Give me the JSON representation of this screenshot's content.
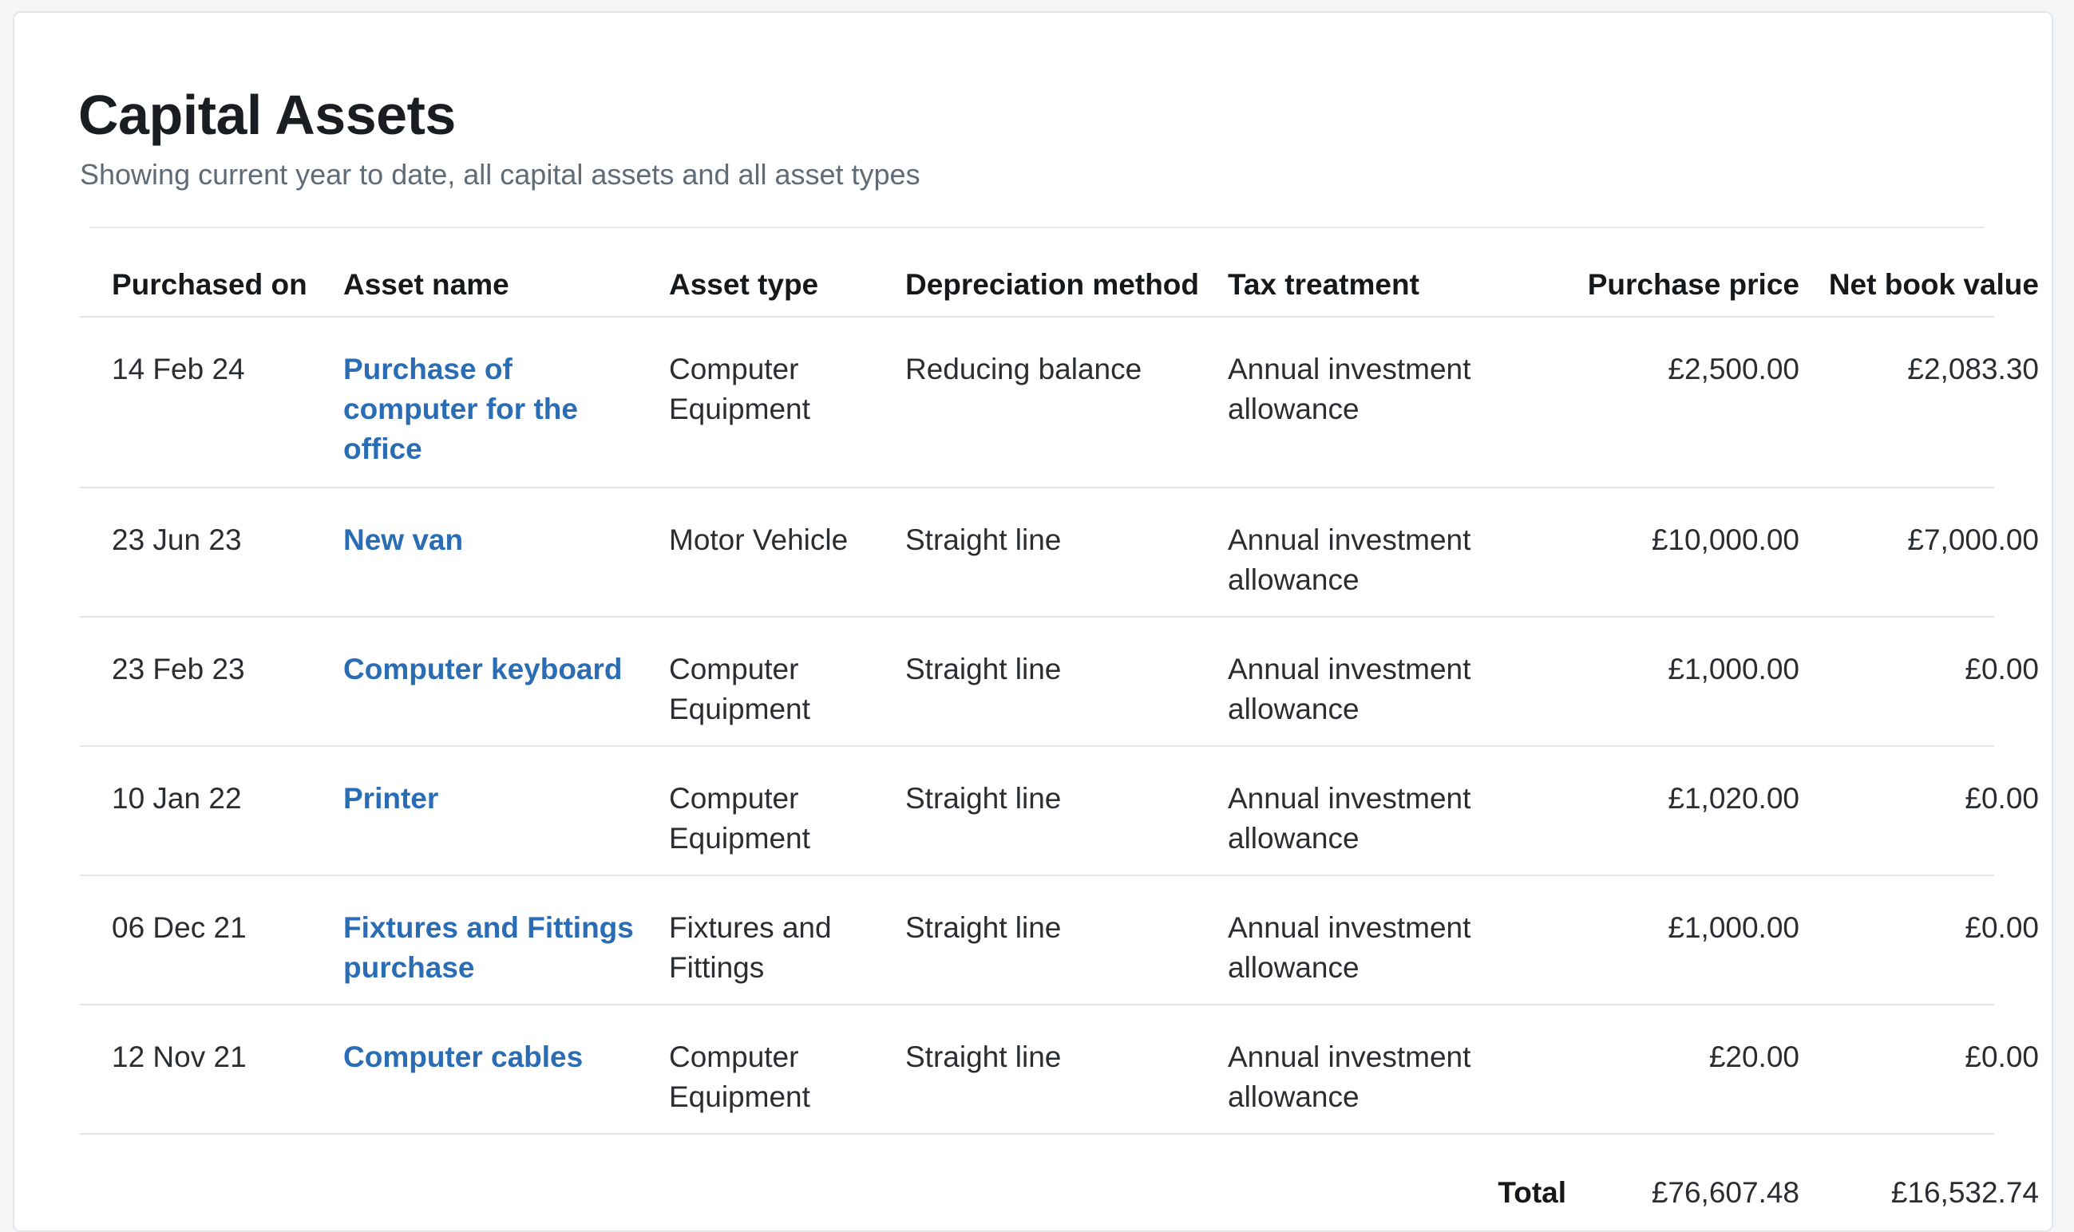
{
  "page": {
    "title": "Capital Assets",
    "subtitle": "Showing current year to date, all capital assets and all asset types"
  },
  "table": {
    "headers": {
      "purchased_on": "Purchased on",
      "asset_name": "Asset name",
      "asset_type": "Asset type",
      "depreciation_method": "Depreciation method",
      "tax_treatment": "Tax treatment",
      "purchase_price": "Purchase price",
      "net_book_value": "Net book value"
    },
    "rows": [
      {
        "purchased_on": "14 Feb 24",
        "asset_name": "Purchase of computer for the office",
        "asset_type": "Computer Equipment",
        "depreciation_method": "Reducing balance",
        "tax_treatment": "Annual investment allowance",
        "purchase_price": "£2,500.00",
        "net_book_value": "£2,083.30"
      },
      {
        "purchased_on": "23 Jun 23",
        "asset_name": "New van",
        "asset_type": "Motor Vehicle",
        "depreciation_method": "Straight line",
        "tax_treatment": "Annual investment allowance",
        "purchase_price": "£10,000.00",
        "net_book_value": "£7,000.00"
      },
      {
        "purchased_on": "23 Feb 23",
        "asset_name": "Computer keyboard",
        "asset_type": "Computer Equipment",
        "depreciation_method": "Straight line",
        "tax_treatment": "Annual investment allowance",
        "purchase_price": "£1,000.00",
        "net_book_value": "£0.00"
      },
      {
        "purchased_on": "10 Jan 22",
        "asset_name": "Printer",
        "asset_type": "Computer Equipment",
        "depreciation_method": "Straight line",
        "tax_treatment": "Annual investment allowance",
        "purchase_price": "£1,020.00",
        "net_book_value": "£0.00"
      },
      {
        "purchased_on": "06 Dec 21",
        "asset_name": "Fixtures and Fittings purchase",
        "asset_type": "Fixtures and Fittings",
        "depreciation_method": "Straight line",
        "tax_treatment": "Annual investment allowance",
        "purchase_price": "£1,000.00",
        "net_book_value": "£0.00"
      },
      {
        "purchased_on": "12 Nov 21",
        "asset_name": "Computer cables",
        "asset_type": "Computer Equipment",
        "depreciation_method": "Straight line",
        "tax_treatment": "Annual investment allowance",
        "purchase_price": "£20.00",
        "net_book_value": "£0.00"
      }
    ],
    "total": {
      "label": "Total",
      "purchase_price": "£76,607.48",
      "net_book_value": "£16,532.74"
    }
  },
  "colors": {
    "link": "#2a6db5",
    "text": "#1f2226",
    "muted": "#5f6b76",
    "divider": "#e2e5e9",
    "background": "#f3f5f7"
  }
}
